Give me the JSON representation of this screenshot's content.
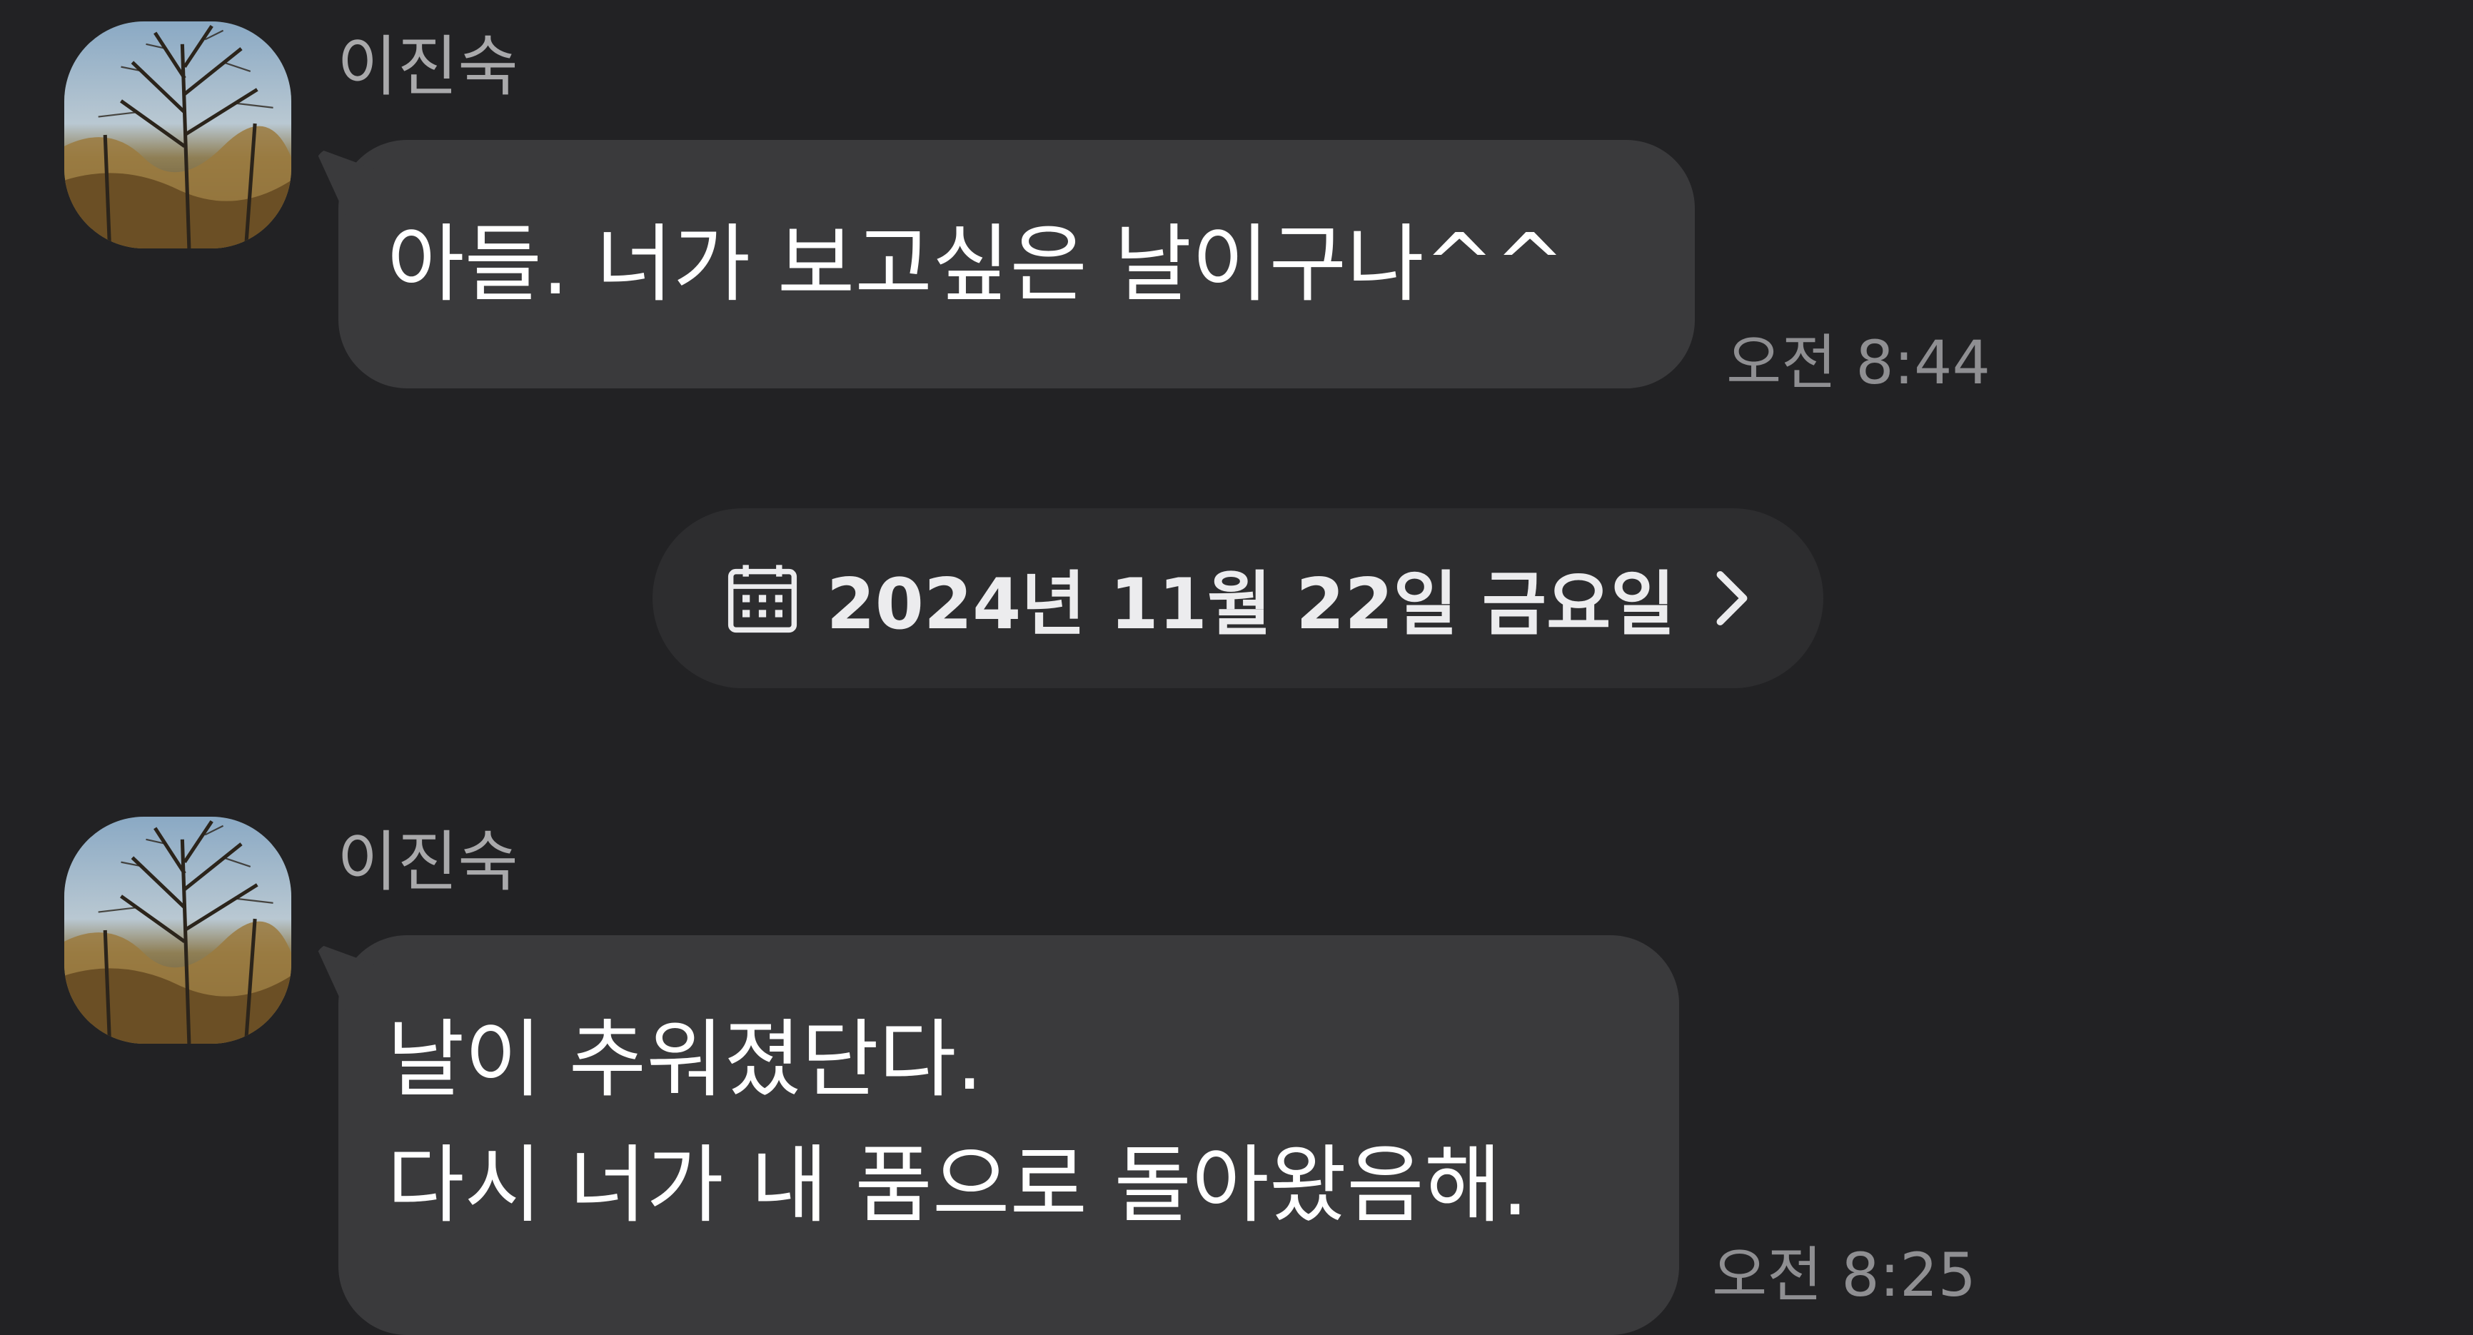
{
  "messages": [
    {
      "sender": "이진숙",
      "text": "아들. 너가 보고싶은 날이구나^^",
      "time": "오전 8:44"
    },
    {
      "sender": "이진숙",
      "text": "날이 추워졌단다.\n다시 너가 내 품으로 돌아왔음해.",
      "time": "오전 8:25"
    }
  ],
  "date_separator": {
    "label": "2024년 11월 22일 금요일",
    "icon": "calendar-icon",
    "chevron_icon": "chevron-right-icon"
  },
  "colors": {
    "background": "#222224",
    "bubble": "#3a3a3c",
    "date_pill": "#2d2d2f",
    "sender_text": "#a9a9ab",
    "time_text": "#8f8f92",
    "message_text": "#ffffff"
  }
}
